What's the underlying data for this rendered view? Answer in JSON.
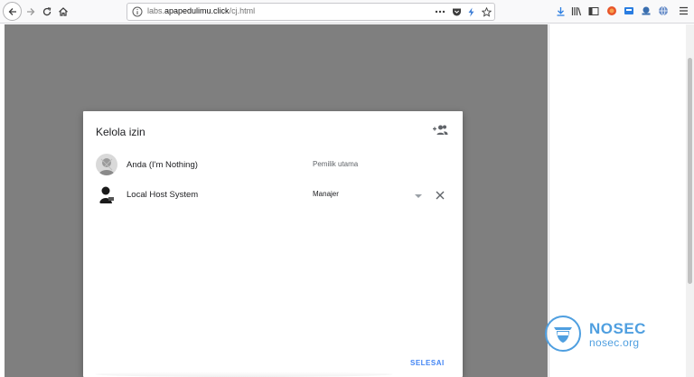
{
  "browser": {
    "url_prefix": "labs.",
    "url_domain": "apapedulimu.click",
    "url_path": "/cj.html"
  },
  "dialog": {
    "title": "Kelola izin",
    "people": [
      {
        "name": "Anda (I'm Nothing)",
        "role": "Pemilik utama"
      },
      {
        "name": "Local Host System",
        "role": "Manajer"
      }
    ],
    "done_label": "SELESAI"
  },
  "watermark": {
    "name": "NOSEC",
    "site": "nosec.org"
  },
  "colors": {
    "accent": "#4285f4",
    "overlay": "#7f7f7f",
    "watermark": "#4f9fe0"
  }
}
